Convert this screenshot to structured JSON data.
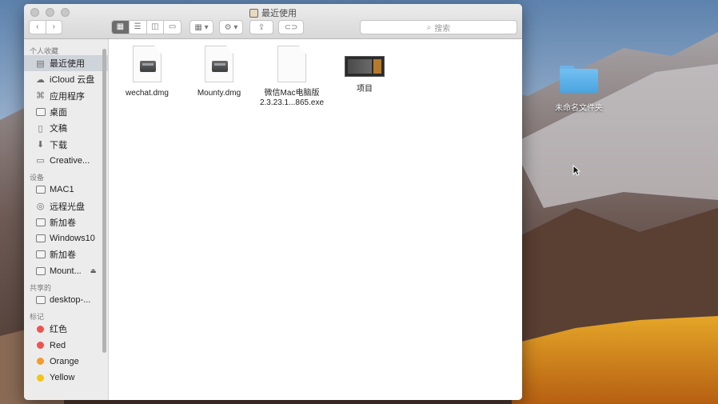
{
  "window": {
    "title": "最近使用"
  },
  "toolbar": {
    "back": "‹",
    "forward": "›",
    "views": [
      "▦",
      "☰",
      "◫",
      "▭"
    ],
    "arrange": "▦ ▾",
    "action": "⚙ ▾",
    "share": "⇪",
    "tag": "⊂⊃",
    "search_placeholder": "搜索"
  },
  "sidebar": {
    "sections": [
      {
        "heading": "个人收藏",
        "items": [
          {
            "label": "最近使用",
            "icon": "recents-icon",
            "selected": true
          },
          {
            "label": "iCloud 云盘",
            "icon": "cloud-icon"
          },
          {
            "label": "应用程序",
            "icon": "applications-icon"
          },
          {
            "label": "桌面",
            "icon": "desktop-icon"
          },
          {
            "label": "文稿",
            "icon": "documents-icon"
          },
          {
            "label": "下载",
            "icon": "downloads-icon"
          },
          {
            "label": "Creative...",
            "icon": "folder-icon"
          }
        ]
      },
      {
        "heading": "设备",
        "items": [
          {
            "label": "MAC1",
            "icon": "disk-icon"
          },
          {
            "label": "远程光盘",
            "icon": "optical-disc-icon"
          },
          {
            "label": "新加卷",
            "icon": "disk-icon"
          },
          {
            "label": "Windows10",
            "icon": "disk-icon"
          },
          {
            "label": "新加卷",
            "icon": "disk-icon"
          },
          {
            "label": "Mount...",
            "icon": "disk-icon",
            "eject": "⏏"
          }
        ]
      },
      {
        "heading": "共享的",
        "items": [
          {
            "label": "desktop-...",
            "icon": "computer-icon"
          }
        ]
      },
      {
        "heading": "标记",
        "items": [
          {
            "label": "红色",
            "icon": "tag-dot-icon",
            "color": "#ef5350"
          },
          {
            "label": "Red",
            "icon": "tag-dot-icon",
            "color": "#ef5350"
          },
          {
            "label": "Orange",
            "icon": "tag-dot-icon",
            "color": "#f59a2e"
          },
          {
            "label": "Yellow",
            "icon": "tag-dot-icon",
            "color": "#f4c414"
          }
        ]
      }
    ]
  },
  "files": [
    {
      "name": "wechat.dmg",
      "kind": "dmg"
    },
    {
      "name": "Mounty.dmg",
      "kind": "dmg"
    },
    {
      "name": "微信Mac电脑版\n2.3.23.1...865.exe",
      "kind": "doc"
    },
    {
      "name": "项目",
      "kind": "image"
    }
  ],
  "desktop": {
    "folder_label": "未命名文件夹"
  }
}
